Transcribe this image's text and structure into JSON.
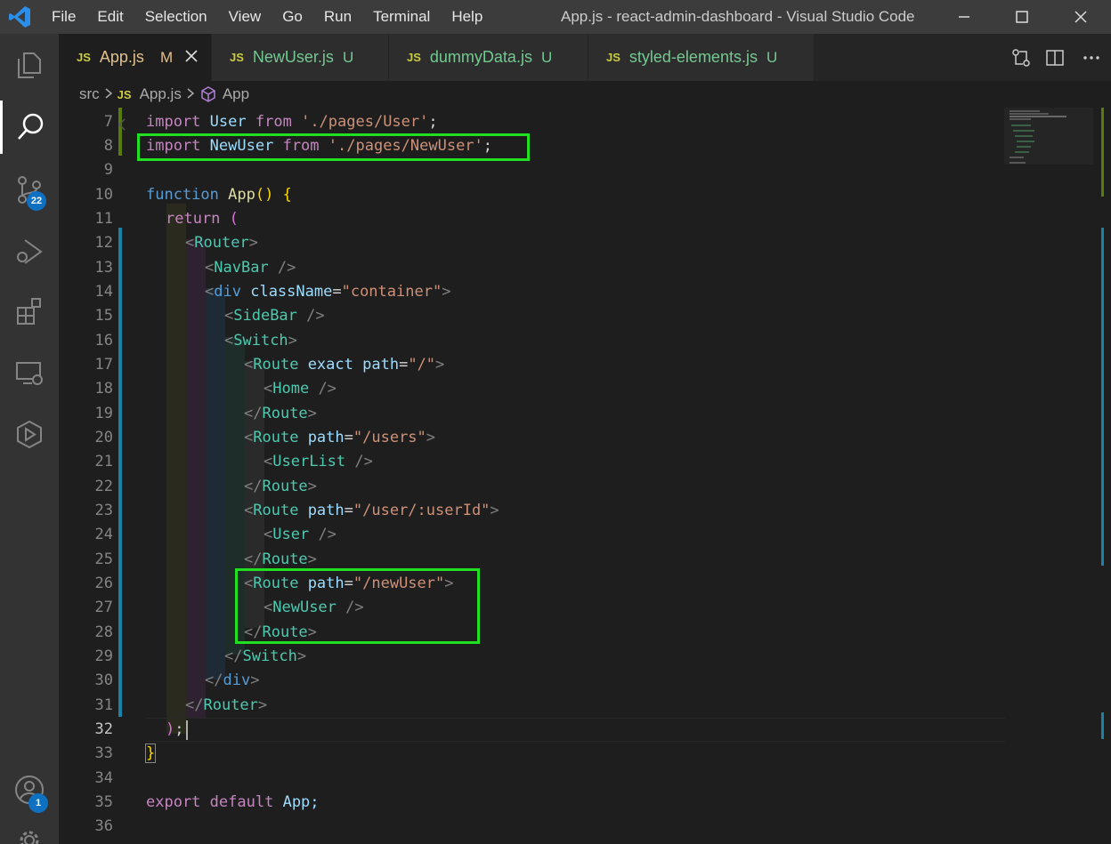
{
  "titlebar": {
    "menu": [
      "File",
      "Edit",
      "Selection",
      "View",
      "Go",
      "Run",
      "Terminal",
      "Help"
    ],
    "window_title": "App.js - react-admin-dashboard - Visual Studio Code"
  },
  "activity_bar": {
    "source_control_badge": "22",
    "accounts_badge": "1"
  },
  "tabs": [
    {
      "icon": "JS",
      "name": "App.js",
      "status": "M",
      "active": true
    },
    {
      "icon": "JS",
      "name": "NewUser.js",
      "status": "U",
      "active": false
    },
    {
      "icon": "JS",
      "name": "dummyData.js",
      "status": "U",
      "active": false
    },
    {
      "icon": "JS",
      "name": "styled-elements.js",
      "status": "U",
      "active": false
    }
  ],
  "breadcrumb": {
    "folder": "src",
    "file_icon": "JS",
    "file": "App.js",
    "symbol": "App"
  },
  "editor": {
    "current_line": "32",
    "lines": [
      {
        "n": "7"
      },
      {
        "n": "8"
      },
      {
        "n": "9"
      },
      {
        "n": "10"
      },
      {
        "n": "11"
      },
      {
        "n": "12"
      },
      {
        "n": "13"
      },
      {
        "n": "14"
      },
      {
        "n": "15"
      },
      {
        "n": "16"
      },
      {
        "n": "17"
      },
      {
        "n": "18"
      },
      {
        "n": "19"
      },
      {
        "n": "20"
      },
      {
        "n": "21"
      },
      {
        "n": "22"
      },
      {
        "n": "23"
      },
      {
        "n": "24"
      },
      {
        "n": "25"
      },
      {
        "n": "26"
      },
      {
        "n": "27"
      },
      {
        "n": "28"
      },
      {
        "n": "29"
      },
      {
        "n": "30"
      },
      {
        "n": "31"
      },
      {
        "n": "32"
      },
      {
        "n": "33"
      },
      {
        "n": "34"
      },
      {
        "n": "35"
      },
      {
        "n": "36"
      }
    ],
    "tokens": {
      "import": "import",
      "from": "from",
      "user": "User",
      "user_path": "'./pages/User'",
      "newuser": "NewUser",
      "newuser_path": "'./pages/NewUser'",
      "semi": ";",
      "function": "function",
      "app": "App",
      "parens": "()",
      "open_brace": "{",
      "close_brace": "}",
      "return": "return",
      "open_paren": "(",
      "close_paren": ")",
      "lt": "<",
      "gt": ">",
      "lt_slash": "</",
      "self_close": " />",
      "router": "Router",
      "navbar": "NavBar",
      "div": "div",
      "classname": "className",
      "eq": "=",
      "container": "\"container\"",
      "sidebar": "SideBar",
      "switch": "Switch",
      "route": "Route",
      "exact": "exact",
      "path": "path",
      "path_root": "\"/\"",
      "home": "Home",
      "path_users": "\"/users\"",
      "userlist": "UserList",
      "path_user_id": "\"/user/:userId\"",
      "path_newuser": "\"/newUser\"",
      "export": "export",
      "default": "default",
      "app_semi": "App;"
    }
  },
  "colors": {
    "highlight": "#21e021",
    "modified": "#e2c08d",
    "untracked": "#73c991"
  }
}
